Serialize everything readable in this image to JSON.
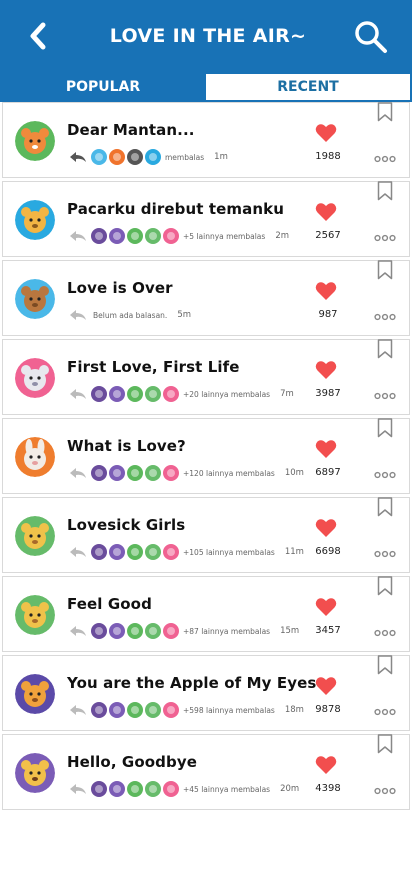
{
  "header": {
    "title": "LOVE IN THE AIR~",
    "back_icon": "chevron-left-icon",
    "search_icon": "search-icon",
    "color": "#1872b6"
  },
  "tabs": [
    {
      "label": "POPULAR",
      "active": true
    },
    {
      "label": "RECENT",
      "active": false
    }
  ],
  "colors": {
    "accent": "#1872b6",
    "heart": "#f24e4e"
  },
  "posts": [
    {
      "title": "Dear Mantan...",
      "avatar": "cat-avatar",
      "reply_text": "membalas",
      "time": "1m",
      "likes": "1988"
    },
    {
      "title": "Pacarku direbut temanku",
      "avatar": "giraffe-avatar",
      "reply_text": "+5 lainnya membalas",
      "time": "2m",
      "likes": "2567"
    },
    {
      "title": "Love is Over",
      "avatar": "bear-avatar",
      "reply_text": "Belum ada balasan.",
      "time": "5m",
      "likes": "987"
    },
    {
      "title": "First Love, First Life",
      "avatar": "sheep-avatar",
      "reply_text": "+20 lainnya membalas",
      "time": "7m",
      "likes": "3987"
    },
    {
      "title": "What is Love?",
      "avatar": "rabbit-avatar",
      "reply_text": "+120 lainnya membalas",
      "time": "10m",
      "likes": "6897"
    },
    {
      "title": "Lovesick Girls",
      "avatar": "lion-avatar",
      "reply_text": "+105 lainnya membalas",
      "time": "11m",
      "likes": "6698"
    },
    {
      "title": "Feel Good",
      "avatar": "lion-avatar",
      "reply_text": "+87 lainnya membalas",
      "time": "15m",
      "likes": "3457"
    },
    {
      "title": "You are the Apple of My Eyes",
      "avatar": "dog-avatar",
      "reply_text": "+598 lainnya membalas",
      "time": "18m",
      "likes": "9878"
    },
    {
      "title": "Hello, Goodbye",
      "avatar": "leopard-avatar",
      "reply_text": "+45 lainnya membalas",
      "time": "20m",
      "likes": "4398"
    }
  ]
}
